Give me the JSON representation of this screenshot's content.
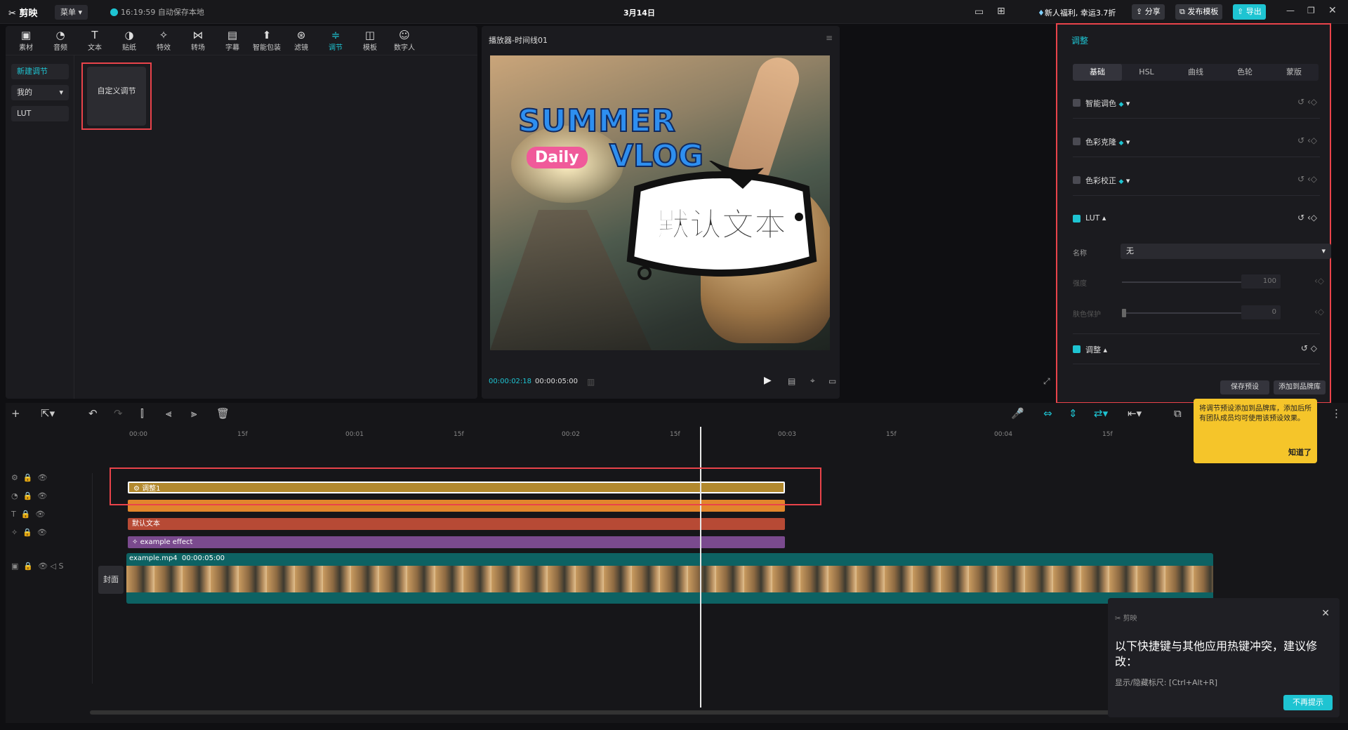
{
  "titlebar": {
    "logo": "剪映",
    "menu": "菜单",
    "autosave": "16:19:59 自动保存本地",
    "date": "3月14日",
    "promo": "新人福利, 幸运3.7折",
    "share": "分享",
    "publish": "发布模板",
    "export": "导出"
  },
  "toolbar": [
    {
      "icon": "▣",
      "label": "素材"
    },
    {
      "icon": "◔",
      "label": "音频"
    },
    {
      "icon": "T",
      "label": "文本"
    },
    {
      "icon": "◑",
      "label": "贴纸"
    },
    {
      "icon": "✧",
      "label": "特效"
    },
    {
      "icon": "⋈",
      "label": "转场"
    },
    {
      "icon": "▤",
      "label": "字幕"
    },
    {
      "icon": "⬆",
      "label": "智能包装"
    },
    {
      "icon": "⊛",
      "label": "滤镜"
    },
    {
      "icon": "≑",
      "label": "调节"
    },
    {
      "icon": "◫",
      "label": "模板"
    },
    {
      "icon": "☺",
      "label": "数字人"
    }
  ],
  "sidebar": {
    "new": "新建调节",
    "mine": "我的",
    "lut": "LUT"
  },
  "custom_card": "自定义调节",
  "player": {
    "title": "播放器-时间线01",
    "time_current": "00:00:02:18",
    "time_total": "00:00:05:00",
    "text_overlay": "默认文本",
    "sticker_summer": "SUMMER",
    "sticker_daily": "Daily",
    "sticker_vlog": "VLOG"
  },
  "adjust": {
    "title": "调整",
    "tabs": [
      "基础",
      "HSL",
      "曲线",
      "色轮",
      "蒙版"
    ],
    "rows": [
      {
        "label": "智能调色"
      },
      {
        "label": "色彩克隆"
      },
      {
        "label": "色彩校正"
      },
      {
        "label": "LUT"
      },
      {
        "label": "调整"
      }
    ],
    "lut_name_label": "名称",
    "lut_name_value": "无",
    "strength_label": "强度",
    "strength_value": "100",
    "skin_label": "肤色保护",
    "skin_value": "0",
    "save_preset": "保存预设",
    "add_brand": "添加到品牌库"
  },
  "timeline": {
    "ticks": [
      "00:00",
      "15f",
      "00:01",
      "15f",
      "00:02",
      "15f",
      "00:03",
      "15f",
      "00:04",
      "15f"
    ],
    "tracks": {
      "adjust": "调整1",
      "text": "默认文本",
      "effect": "example effect",
      "video_name": "example.mp4",
      "video_duration": "00:00:05:00"
    },
    "cover": "封面",
    "playhead_fraction": 0.56
  },
  "tip": {
    "text": "将调节预设添加到品牌库，添加后所有团队成员均可使用该预设效果。",
    "ok": "知道了"
  },
  "toast": {
    "logo": "剪映",
    "message": "以下快捷键与其他应用热键冲突，建议修改：",
    "keys": "显示/隐藏标尺: [Ctrl+Alt+R]",
    "dismiss": "不再提示"
  },
  "colors": {
    "accent": "#1ec4d2",
    "highlight": "#e9434a",
    "adjust_track": "#b2892e",
    "sticker_track": "#e2862c",
    "text_track": "#b74a35",
    "effect_track": "#7a4a8e",
    "video_track": "#0d6263"
  }
}
